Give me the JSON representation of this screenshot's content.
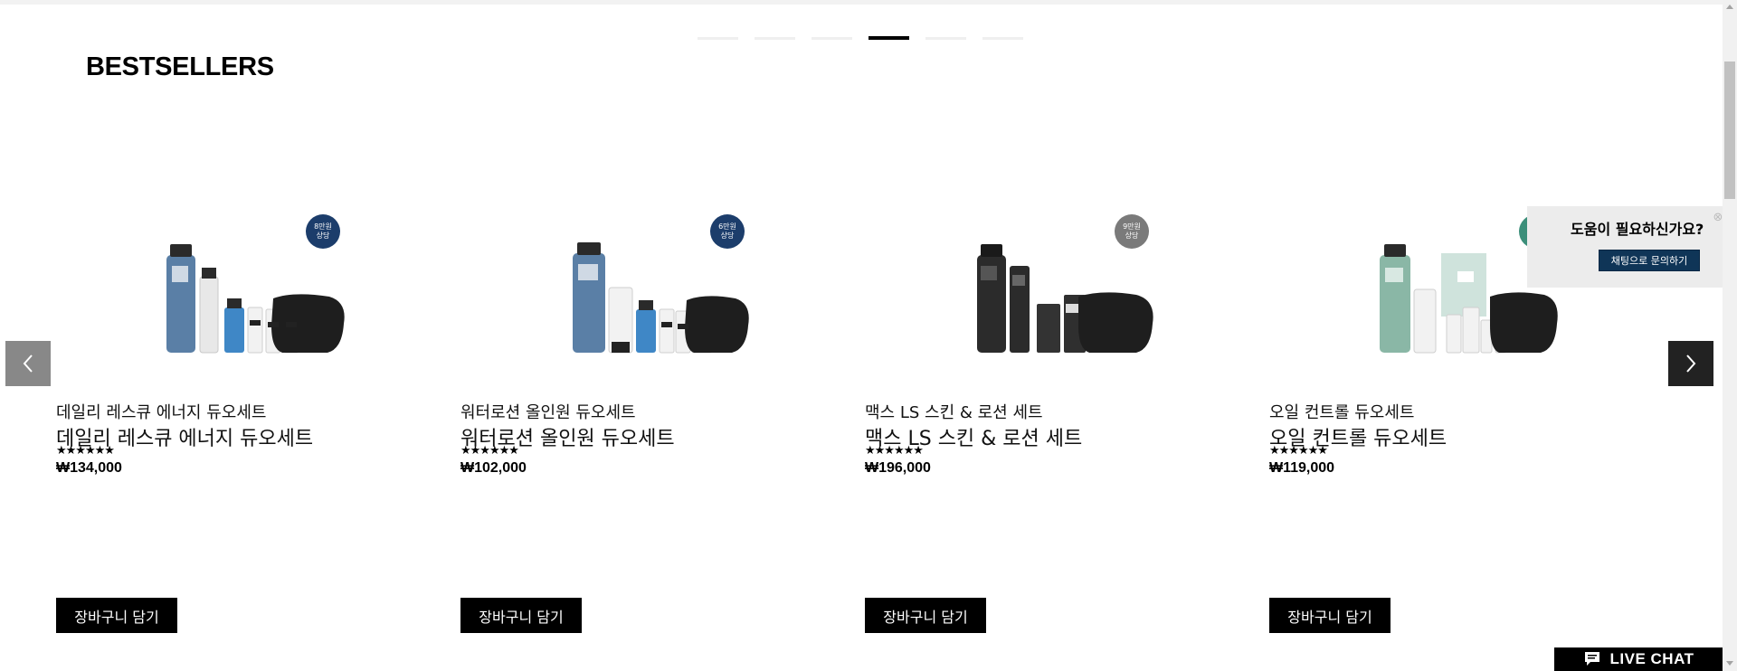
{
  "section": {
    "title": "BESTSELLERS"
  },
  "carousel": {
    "pagination": [
      {
        "label": "slide 1",
        "active": false
      },
      {
        "label": "slide 2",
        "active": false
      },
      {
        "label": "slide 3",
        "active": false
      },
      {
        "label": "slide 4",
        "active": true
      },
      {
        "label": "slide 5",
        "active": false
      },
      {
        "label": "slide 6",
        "active": false
      }
    ],
    "prev_icon": "chevron-left-icon",
    "next_icon": "chevron-right-icon"
  },
  "products": [
    {
      "name_small": "데일리 레스큐 에너지 듀오세트",
      "name_large": "데일리 레스큐 에너지 듀오세트",
      "stars": "★★★★★★",
      "rating_stars": 5,
      "price": "₩134,000",
      "badge_line1": "8만원",
      "badge_line2": "상당",
      "badge_color": "#1c3d6b",
      "cart_label": "장바구니 담기"
    },
    {
      "name_small": "워터로션 올인원 듀오세트",
      "name_large": "워터로션 올인원 듀오세트",
      "stars": "★★★★★★",
      "rating_stars": 5,
      "price": "₩102,000",
      "badge_line1": "6만원",
      "badge_line2": "상당",
      "badge_color": "#1c3d6b",
      "cart_label": "장바구니 담기"
    },
    {
      "name_small": "맥스 LS 스킨 & 로션 세트",
      "name_large": "맥스 LS 스킨 & 로션 세트",
      "stars": "★★★★★★",
      "rating_stars": 5,
      "price": "₩196,000",
      "badge_line1": "9만원",
      "badge_line2": "상당",
      "badge_color": "#7a7a7a",
      "cart_label": "장바구니 담기"
    },
    {
      "name_small": "오일 컨트롤 듀오세트",
      "name_large": "오일 컨트롤 듀오세트",
      "stars": "★★★★★★",
      "rating_stars": 5,
      "price": "₩119,000",
      "badge_line1": "",
      "badge_line2": "",
      "badge_color": "#3c8f7a",
      "cart_label": "장바구니 담기"
    }
  ],
  "help_popup": {
    "title": "도움이 필요하신가요?",
    "button": "채팅으로 문의하기",
    "close_icon": "close-icon"
  },
  "live_chat": {
    "label": "LIVE CHAT",
    "icon": "chat-bubble-icon"
  }
}
